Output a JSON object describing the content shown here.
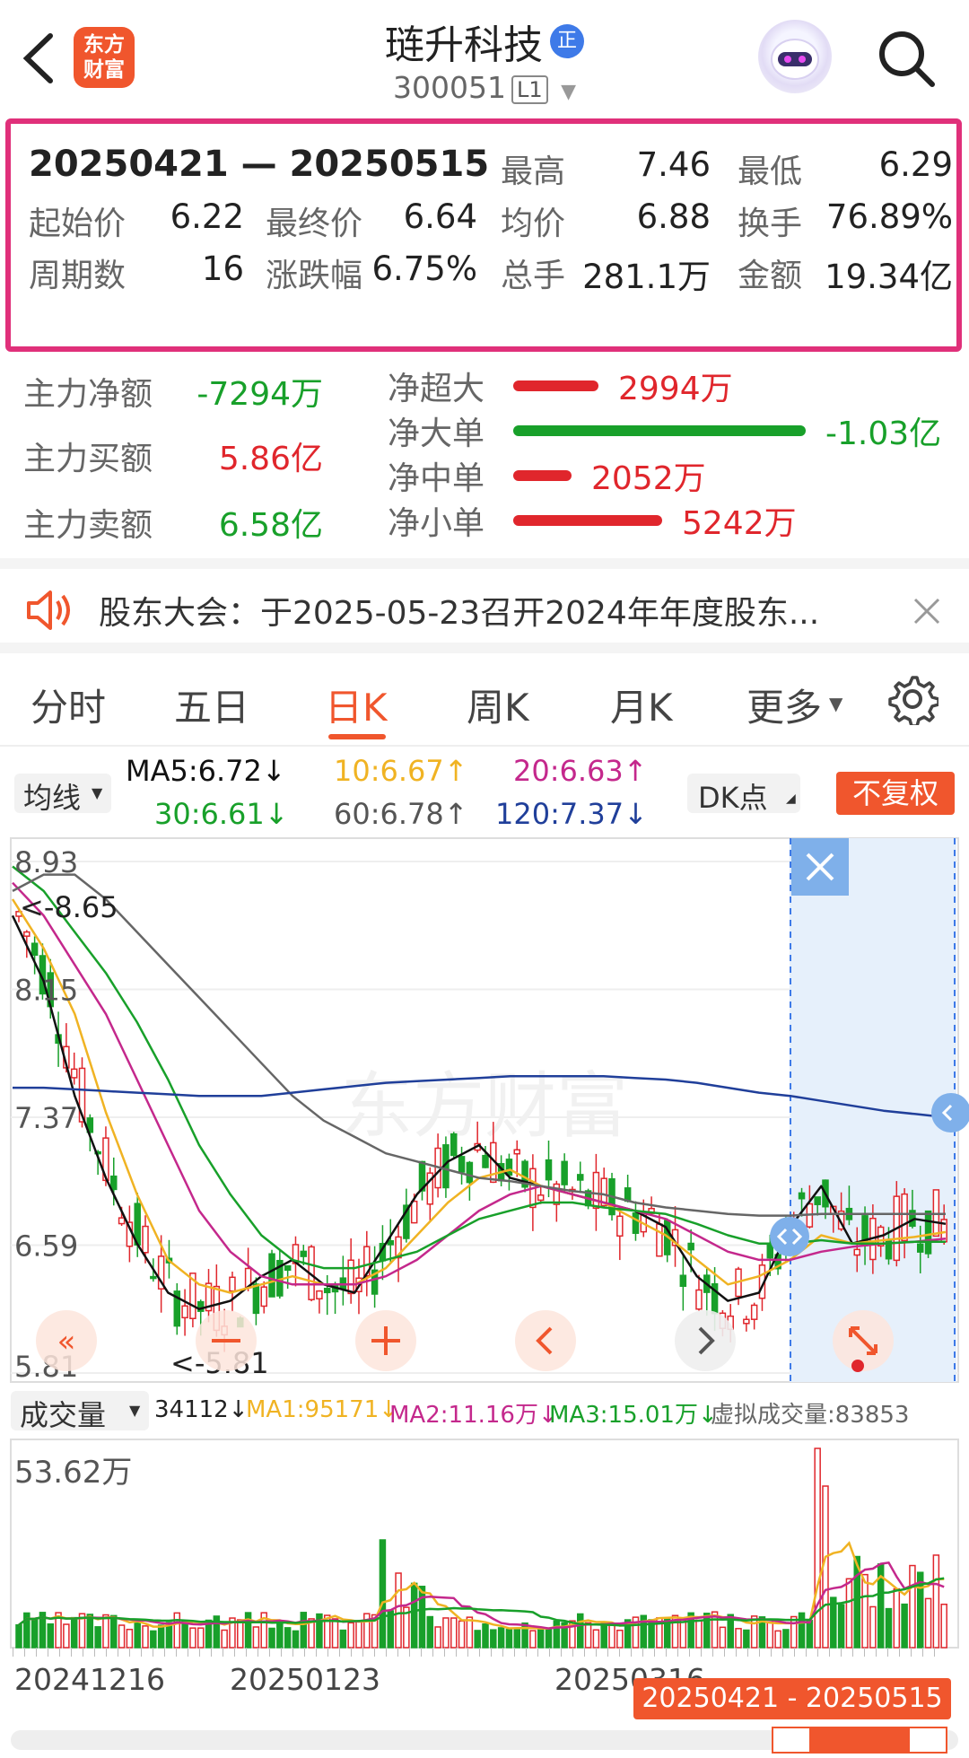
{
  "header": {
    "stock_name": "琏升科技",
    "badge": "正",
    "stock_code": "300051",
    "level": "L1",
    "logo_line1": "东方",
    "logo_line2": "财富"
  },
  "stats": {
    "date_range": "20250421 — 20250515",
    "high_label": "最高",
    "high": "7.46",
    "low_label": "最低",
    "low": "6.29",
    "open_label": "起始价",
    "open": "6.22",
    "close_label": "最终价",
    "close": "6.64",
    "avg_label": "均价",
    "avg": "6.88",
    "turnover_label": "换手",
    "turnover": "76.89%",
    "periods_label": "周期数",
    "periods": "16",
    "change_label": "涨跌幅",
    "change": "6.75%",
    "volume_label": "总手",
    "volume": "281.1万",
    "amount_label": "金额",
    "amount": "19.34亿"
  },
  "fund_flow": {
    "main_net_label": "主力净额",
    "main_net": "-7294万",
    "main_buy_label": "主力买额",
    "main_buy": "5.86亿",
    "main_sell_label": "主力卖额",
    "main_sell": "6.58亿",
    "items": [
      {
        "label": "净超大",
        "value": "2994万",
        "magnitude": 2994
      },
      {
        "label": "净大单",
        "value": "-1.03亿",
        "magnitude": 10300
      },
      {
        "label": "净中单",
        "value": "2052万",
        "magnitude": 2052
      },
      {
        "label": "净小单",
        "value": "5242万",
        "magnitude": 5242
      }
    ]
  },
  "notice": {
    "text": "股东大会：于2025-05-23召开2024年年度股东..."
  },
  "tabs": [
    "分时",
    "五日",
    "日K",
    "周K",
    "月K",
    "更多"
  ],
  "active_tab": "日K",
  "ma": {
    "selector": "均线",
    "ma5": "MA5:6.72↓",
    "ma10": "10:6.67↑",
    "ma20": "20:6.63↑",
    "ma30": "30:6.61↓",
    "ma60": "60:6.78↑",
    "ma120": "120:7.37↓",
    "dk": "DK点",
    "adjust": "不复权"
  },
  "chart_labels": {
    "y_ticks": [
      "8.93",
      "8.15",
      "7.37",
      "6.59",
      "5.81"
    ],
    "max_note": "<-8.65",
    "min_note": "<-5.81",
    "watermark": "东方财富"
  },
  "volume": {
    "selector": "成交量",
    "vol": "34112↓",
    "ma1": "MA1:95171↓",
    "ma2": "MA2:11.16万↓",
    "ma3": "MA3:15.01万↓",
    "virtual": "虚拟成交量:83853",
    "max": "53.62万"
  },
  "x_axis": {
    "d1": "20241216",
    "d2": "20250123",
    "d3": "20250316",
    "range": "20250421 - 20250515"
  },
  "colors": {
    "up": "#e0262c",
    "down": "#18a02a",
    "accent": "#f0562d",
    "ma5": "#111111",
    "ma10": "#f0b323",
    "ma20": "#c4288c",
    "ma30": "#18a02a",
    "ma60": "#666666",
    "ma120": "#203f9a"
  },
  "chart_data": {
    "type": "line",
    "x_range": [
      "20241216",
      "20250515"
    ],
    "ylim": [
      5.81,
      8.93
    ],
    "series": [
      {
        "name": "MA5",
        "values": [
          8.6,
          8.2,
          7.5,
          7.0,
          6.6,
          6.3,
          6.2,
          6.25,
          6.4,
          6.5,
          6.35,
          6.3,
          6.6,
          6.9,
          7.1,
          7.2,
          7.0,
          6.95,
          6.9,
          6.85,
          6.8,
          6.7,
          6.4,
          6.25,
          6.3,
          6.7,
          6.95,
          6.6,
          6.65,
          6.75,
          6.72
        ]
      },
      {
        "name": "10",
        "values": [
          8.7,
          8.4,
          8.0,
          7.4,
          6.9,
          6.5,
          6.35,
          6.3,
          6.35,
          6.4,
          6.35,
          6.35,
          6.45,
          6.65,
          6.85,
          7.0,
          7.05,
          6.95,
          6.9,
          6.85,
          6.75,
          6.65,
          6.5,
          6.35,
          6.4,
          6.5,
          6.65,
          6.6,
          6.62,
          6.64,
          6.67
        ]
      },
      {
        "name": "20",
        "values": [
          8.8,
          8.6,
          8.3,
          8.0,
          7.6,
          7.2,
          6.8,
          6.55,
          6.4,
          6.35,
          6.35,
          6.35,
          6.4,
          6.5,
          6.65,
          6.8,
          6.9,
          6.95,
          6.9,
          6.85,
          6.8,
          6.75,
          6.65,
          6.55,
          6.5,
          6.5,
          6.55,
          6.58,
          6.6,
          6.61,
          6.63
        ]
      },
      {
        "name": "30",
        "values": [
          8.9,
          8.75,
          8.5,
          8.25,
          7.95,
          7.6,
          7.2,
          6.9,
          6.65,
          6.5,
          6.45,
          6.45,
          6.5,
          6.55,
          6.65,
          6.75,
          6.8,
          6.85,
          6.85,
          6.82,
          6.8,
          6.78,
          6.72,
          6.65,
          6.6,
          6.6,
          6.62,
          6.6,
          6.6,
          6.61,
          6.61
        ]
      },
      {
        "name": "60",
        "values": [
          8.75,
          8.85,
          8.85,
          8.7,
          8.5,
          8.3,
          8.1,
          7.9,
          7.7,
          7.5,
          7.35,
          7.25,
          7.15,
          7.1,
          7.05,
          7.0,
          6.98,
          6.95,
          6.92,
          6.9,
          6.85,
          6.82,
          6.8,
          6.78,
          6.77,
          6.77,
          6.78,
          6.78,
          6.78,
          6.78,
          6.78
        ]
      },
      {
        "name": "120",
        "values": [
          7.55,
          7.55,
          7.54,
          7.53,
          7.52,
          7.51,
          7.5,
          7.5,
          7.5,
          7.52,
          7.54,
          7.56,
          7.58,
          7.59,
          7.6,
          7.61,
          7.62,
          7.62,
          7.62,
          7.62,
          7.61,
          7.6,
          7.58,
          7.55,
          7.52,
          7.5,
          7.47,
          7.44,
          7.41,
          7.39,
          7.37
        ]
      }
    ]
  }
}
